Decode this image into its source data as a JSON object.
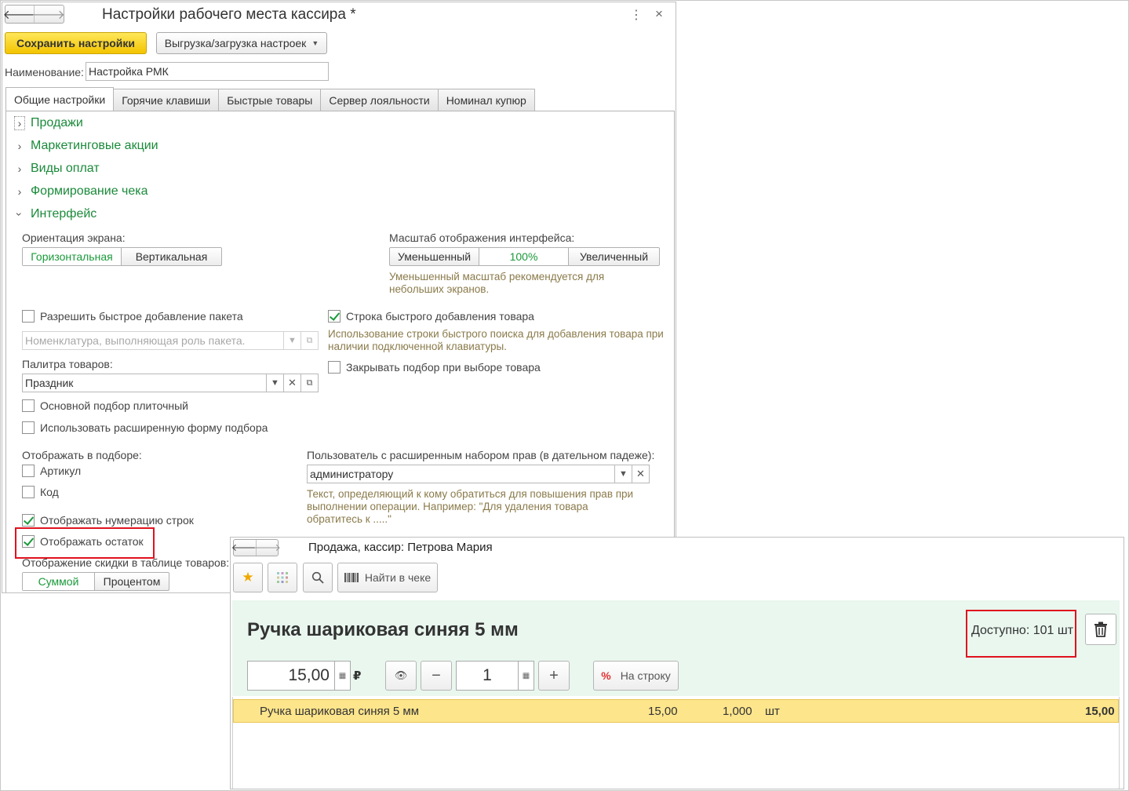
{
  "settings": {
    "title": "Настройки рабочего места кассира *",
    "menu_icon": "⋮",
    "close_icon": "×",
    "save_label": "Сохранить настройки",
    "export_label": "Выгрузка/загрузка настроек",
    "name_label": "Наименование:",
    "name_value": "Настройка РМК",
    "tabs": [
      "Общие настройки",
      "Горячие клавиши",
      "Быстрые товары",
      "Сервер лояльности",
      "Номинал купюр"
    ],
    "groups": [
      "Продажи",
      "Маркетинговые акции",
      "Виды оплат",
      "Формирование чека",
      "Интерфейс"
    ],
    "interface": {
      "orientation_label": "Ориентация экрана:",
      "orientation_options": [
        "Горизонтальная",
        "Вертикальная"
      ],
      "scale_label": "Масштаб отображения интерфейса:",
      "scale_options": [
        "Уменьшенный",
        "100%",
        "Увеличенный"
      ],
      "scale_hint": "Уменьшенный масштаб рекомендуется для небольших экранов.",
      "quick_package_label": "Разрешить быстрое добавление пакета",
      "package_placeholder": "Номенклатура, выполняющая роль пакета.",
      "palette_label": "Палитра товаров:",
      "palette_value": "Праздник",
      "tile_selection_label": "Основной подбор плиточный",
      "extended_form_label": "Использовать расширенную форму подбора",
      "show_in_selection_label": "Отображать в подборе:",
      "article_label": "Артикул",
      "code_label": "Код",
      "row_numbering_label": "Отображать нумерацию строк",
      "show_stock_label": "Отображать остаток",
      "discount_display_label": "Отображение скидки в таблице товаров:",
      "discount_options": [
        "Суммой",
        "Процентом"
      ],
      "quick_add_row_label": "Строка быстрого добавления товара",
      "quick_add_hint": "Использование строки быстрого поиска для добавления товара при наличии подключенной клавиатуры.",
      "close_selection_label": "Закрывать подбор при выборе товара",
      "privileged_user_label": "Пользователь с расширенным набором прав (в дательном падеже):",
      "privileged_user_value": "администратору",
      "privileged_hint": "Текст, определяющий к кому обратиться для повышения прав при выполнении операции. Например: \"Для удаления товара обратитесь к .....\""
    }
  },
  "cashier": {
    "title": "Продажа, кассир: Петрова Мария",
    "find_in_receipt_label": "Найти в чеке",
    "product_name": "Ручка шариковая синяя 5 мм",
    "available_label": "Доступно: 101 шт",
    "price_value": "15,00",
    "currency": "₽",
    "quantity_value": "1",
    "to_row_label": "На строку",
    "minus": "−",
    "plus": "+",
    "row": {
      "name": "Ручка шариковая синяя 5 мм",
      "price": "15,00",
      "qty": "1,000",
      "unit": "шт",
      "sum": "15,00"
    }
  }
}
